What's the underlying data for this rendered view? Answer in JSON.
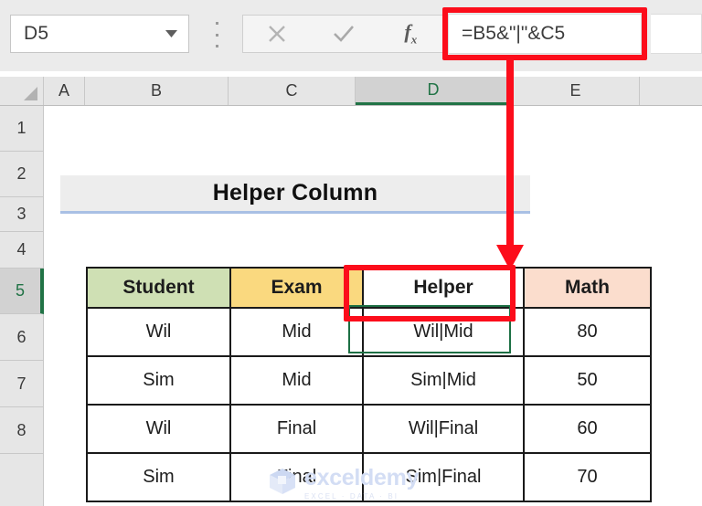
{
  "formula_bar": {
    "name_box_value": "D5",
    "name_box_dropdown_icon": "chevron-down-icon",
    "more_options_icon": "kebab-menu-icon",
    "cancel_icon": "cancel-x-icon",
    "enter_icon": "checkmark-icon",
    "insert_function_icon": "fx-icon",
    "insert_function_label": "fx",
    "formula_value": "=B5&\"|\"&C5"
  },
  "grid": {
    "select_all_icon": "select-all-triangle-icon",
    "column_headers": [
      "A",
      "B",
      "C",
      "D",
      "E"
    ],
    "selected_column": "D",
    "row_headers": [
      "1",
      "2",
      "3",
      "4",
      "5",
      "6",
      "7",
      "8"
    ],
    "selected_row": "5"
  },
  "title": {
    "text": "Helper Column"
  },
  "table": {
    "headers": [
      "Student",
      "Exam",
      "Helper",
      "Math"
    ],
    "header_colors": {
      "Student": "#cfe0b4",
      "Exam": "#fad97f",
      "Helper": "#ffffff",
      "Math": "#fbddcd"
    },
    "rows": [
      {
        "student": "Wil",
        "exam": "Mid",
        "helper": "Wil|Mid",
        "math": "80"
      },
      {
        "student": "Sim",
        "exam": "Mid",
        "helper": "Sim|Mid",
        "math": "50"
      },
      {
        "student": "Wil",
        "exam": "Final",
        "helper": "Wil|Final",
        "math": "60"
      },
      {
        "student": "Sim",
        "exam": "Final",
        "helper": "Sim|Final",
        "math": "70"
      }
    ]
  },
  "annotations": {
    "highlight_color": "#fc0d1b",
    "formula_box_target": "formula bar",
    "cell_box_target": "D5",
    "arrow_icon": "down-arrow-annotation"
  },
  "watermark": {
    "name": "exceldemy",
    "tagline": "EXCEL · DATA · BI",
    "logo_icon": "exceldemy-cube-logo"
  }
}
